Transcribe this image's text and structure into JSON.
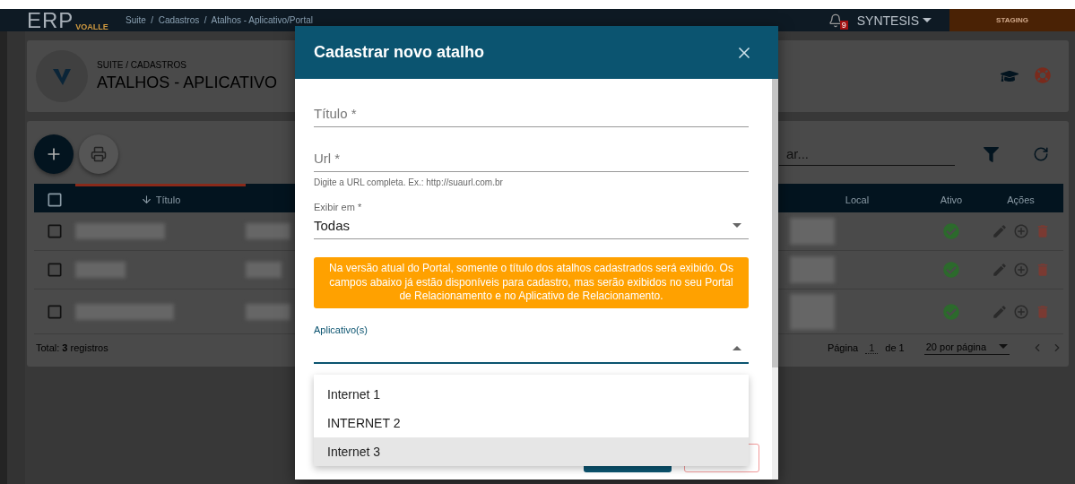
{
  "topbar": {
    "logo": "ERP",
    "logo_sub": "VOALLE",
    "breadcrumb": "Suite  /  Cadastros  /  Atalhos - Aplicativo/Portal",
    "notifications": "9",
    "user": "SYNTESIS",
    "environment": "STAGING"
  },
  "page_header": {
    "section": "SUITE / CADASTROS",
    "title": "ATALHOS - APLICATIVO"
  },
  "list": {
    "search": {
      "placeholder": "ar..."
    },
    "header_checked": false,
    "columns": [
      {
        "label": "Título",
        "sorted": true
      },
      {
        "label": "Local",
        "sorted": false
      },
      {
        "label": "Ativo",
        "sorted": false
      },
      {
        "label": "Ações",
        "sorted": false
      }
    ],
    "rows": [
      {
        "checked": false,
        "active": true
      },
      {
        "checked": false,
        "active": true
      },
      {
        "checked": false,
        "active": true
      }
    ],
    "total": "Total: **3** registros",
    "page_label": "Página",
    "page": "1",
    "page_of": "de 1",
    "per_page": "20 por página"
  },
  "dialog": {
    "title": "Cadastrar novo atalho",
    "fields": [
      {
        "kind": "text",
        "placeholder": "Título *"
      },
      {
        "kind": "text",
        "placeholder": "Url *",
        "hint": "Digite a URL completa. Ex.: http://suaurl.com.br"
      },
      {
        "kind": "select",
        "label": "Exibir em *",
        "value": "Todas",
        "expanded": false
      },
      {
        "kind": "alert",
        "text": "Na versão atual do Portal, somente o título dos atalhos cadastrados será exibido. Os campos abaixo já estão disponíveis para cadastro, mas serão exibidos no seu Portal de Relacionamento e no Aplicativo de Relacionamento."
      },
      {
        "kind": "select",
        "label": "Aplicativo(s)",
        "expanded": true,
        "options": [
          {
            "label": "Internet 1",
            "selected": false
          },
          {
            "label": "INTERNET 2",
            "selected": false
          },
          {
            "label": "Internet 3",
            "selected": true
          }
        ]
      }
    ]
  }
}
